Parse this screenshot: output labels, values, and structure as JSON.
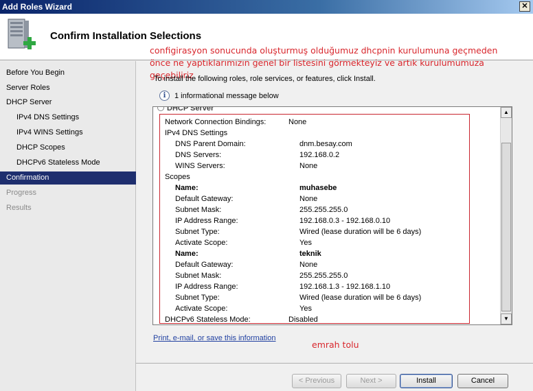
{
  "window": {
    "title": "Add Roles Wizard",
    "close_glyph": "✕"
  },
  "header": {
    "title": "Confirm Installation Selections"
  },
  "annotations": {
    "top": "configirasyon sonucunda oluşturmuş olduğumuz dhcpnin kurulumuna geçmeden önce ne yaptıklarımızın genel bir listesini görmekteyiz ve artık kurulumumuza geçebiliriz",
    "bottom": "emrah tolu"
  },
  "nav": {
    "items": [
      {
        "label": "Before You Begin",
        "level": "top",
        "state": "normal"
      },
      {
        "label": "Server Roles",
        "level": "top",
        "state": "normal"
      },
      {
        "label": "DHCP Server",
        "level": "top",
        "state": "normal"
      },
      {
        "label": "IPv4 DNS Settings",
        "level": "sub",
        "state": "normal"
      },
      {
        "label": "IPv4 WINS Settings",
        "level": "sub",
        "state": "normal"
      },
      {
        "label": "DHCP Scopes",
        "level": "sub",
        "state": "normal"
      },
      {
        "label": "DHCPv6 Stateless Mode",
        "level": "sub",
        "state": "normal"
      },
      {
        "label": "Confirmation",
        "level": "top",
        "state": "active"
      },
      {
        "label": "Progress",
        "level": "top",
        "state": "disabled"
      },
      {
        "label": "Results",
        "level": "top",
        "state": "disabled"
      }
    ]
  },
  "main": {
    "intro": "To install the following roles, role services, or features, click Install.",
    "info_message": "1 informational message below",
    "info_icon_glyph": "i",
    "partial_header": "DHCP Server",
    "rows": [
      {
        "label": "Network Connection Bindings:",
        "value": "None",
        "indent": 0,
        "bold": false
      },
      {
        "label": "IPv4 DNS Settings",
        "value": "",
        "indent": 0,
        "bold": false
      },
      {
        "label": "DNS Parent Domain:",
        "value": "dnm.besay.com",
        "indent": 1,
        "bold": false
      },
      {
        "label": "DNS Servers:",
        "value": "192.168.0.2",
        "indent": 1,
        "bold": false
      },
      {
        "label": "WINS Servers:",
        "value": "None",
        "indent": 1,
        "bold": false
      },
      {
        "label": "Scopes",
        "value": "",
        "indent": 0,
        "bold": false
      },
      {
        "label": "Name:",
        "value": "muhasebe",
        "indent": 1,
        "bold": true
      },
      {
        "label": "Default Gateway:",
        "value": "None",
        "indent": 1,
        "bold": false
      },
      {
        "label": "Subnet Mask:",
        "value": "255.255.255.0",
        "indent": 1,
        "bold": false
      },
      {
        "label": "IP Address Range:",
        "value": "192.168.0.3 - 192.168.0.10",
        "indent": 1,
        "bold": false
      },
      {
        "label": "Subnet Type:",
        "value": "Wired (lease duration will be 6 days)",
        "indent": 1,
        "bold": false
      },
      {
        "label": "Activate Scope:",
        "value": "Yes",
        "indent": 1,
        "bold": false
      },
      {
        "label": "Name:",
        "value": "teknik",
        "indent": 1,
        "bold": true
      },
      {
        "label": "Default Gateway:",
        "value": "None",
        "indent": 1,
        "bold": false
      },
      {
        "label": "Subnet Mask:",
        "value": "255.255.255.0",
        "indent": 1,
        "bold": false
      },
      {
        "label": "IP Address Range:",
        "value": "192.168.1.3 - 192.168.1.10",
        "indent": 1,
        "bold": false
      },
      {
        "label": "Subnet Type:",
        "value": "Wired (lease duration will be 6 days)",
        "indent": 1,
        "bold": false
      },
      {
        "label": "Activate Scope:",
        "value": "Yes",
        "indent": 1,
        "bold": false
      },
      {
        "label": "DHCPv6 Stateless Mode:",
        "value": "Disabled",
        "indent": 0,
        "bold": false
      }
    ],
    "scroll_up_glyph": "▲",
    "scroll_down_glyph": "▼",
    "print_link": "Print, e-mail, or save this information"
  },
  "buttons": {
    "previous": "< Previous",
    "next": "Next >",
    "install": "Install",
    "cancel": "Cancel"
  },
  "colors": {
    "annotation": "#d8262c",
    "active_nav": "#1e2e6e",
    "link": "#1f3fa0"
  }
}
